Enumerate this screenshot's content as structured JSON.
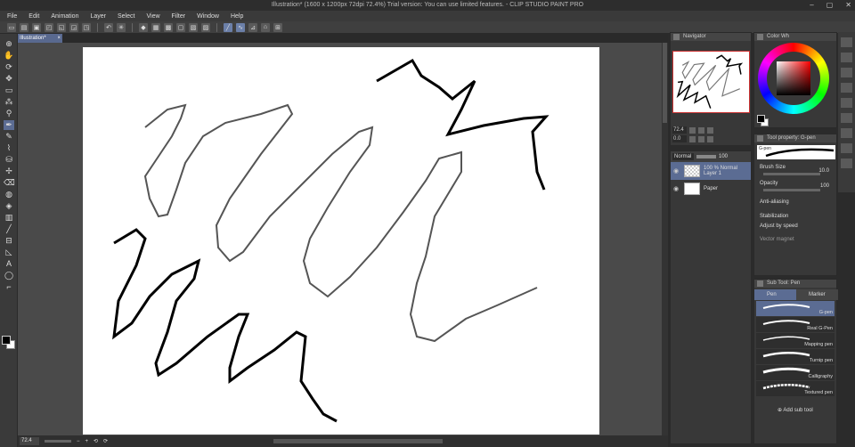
{
  "window": {
    "title": "Illustration* (1600 x 1200px 72dpi 72.4%)  Trial version: You can use limited features. - CLIP STUDIO PAINT PRO",
    "controls": [
      "–",
      "▢",
      "✕"
    ]
  },
  "menu": [
    "File",
    "Edit",
    "Animation",
    "Layer",
    "Select",
    "View",
    "Filter",
    "Window",
    "Help"
  ],
  "document_tab": {
    "label": "Illustration*",
    "close": "×"
  },
  "status": {
    "zoom": "72.4"
  },
  "navigator": {
    "title": "Navigator",
    "zoom": "72.4",
    "rotation": "0.0"
  },
  "layers": {
    "blend_mode": "Normal",
    "opacity": "100",
    "items": [
      {
        "meta": "100 % Normal",
        "name": "Layer 1"
      },
      {
        "name": "Paper"
      }
    ]
  },
  "color": {
    "title": "Color Wh",
    "fg": "#000000",
    "bg": "#ffffff"
  },
  "tool_property": {
    "title": "Tool property: G-pen",
    "brush_name": "G-pen",
    "brush_size_label": "Brush Size",
    "brush_size_value": "10.0",
    "opacity_label": "Opacity",
    "opacity_value": "100",
    "antialias_label": "Anti-aliasing",
    "stabilization_label": "Stabilization",
    "adjust_label": "Adjust by speed",
    "vector_label": "Vector magnet"
  },
  "sub_tool": {
    "title": "Sub Tool: Pen",
    "tabs": [
      "Pen",
      "Marker"
    ],
    "brushes": [
      "G-pen",
      "Real G-Pen",
      "Mapping pen",
      "Turnip pen",
      "Calligraphy",
      "Textured pen"
    ],
    "add_label": "Add sub tool"
  }
}
